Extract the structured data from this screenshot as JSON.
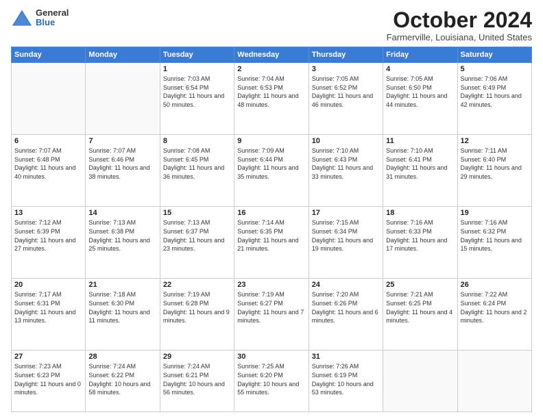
{
  "header": {
    "logo_general": "General",
    "logo_blue": "Blue",
    "month_title": "October 2024",
    "subtitle": "Farmerville, Louisiana, United States"
  },
  "days_of_week": [
    "Sunday",
    "Monday",
    "Tuesday",
    "Wednesday",
    "Thursday",
    "Friday",
    "Saturday"
  ],
  "weeks": [
    [
      {
        "day": "",
        "info": ""
      },
      {
        "day": "",
        "info": ""
      },
      {
        "day": "1",
        "info": "Sunrise: 7:03 AM\nSunset: 6:54 PM\nDaylight: 11 hours and 50 minutes."
      },
      {
        "day": "2",
        "info": "Sunrise: 7:04 AM\nSunset: 6:53 PM\nDaylight: 11 hours and 48 minutes."
      },
      {
        "day": "3",
        "info": "Sunrise: 7:05 AM\nSunset: 6:52 PM\nDaylight: 11 hours and 46 minutes."
      },
      {
        "day": "4",
        "info": "Sunrise: 7:05 AM\nSunset: 6:50 PM\nDaylight: 11 hours and 44 minutes."
      },
      {
        "day": "5",
        "info": "Sunrise: 7:06 AM\nSunset: 6:49 PM\nDaylight: 11 hours and 42 minutes."
      }
    ],
    [
      {
        "day": "6",
        "info": "Sunrise: 7:07 AM\nSunset: 6:48 PM\nDaylight: 11 hours and 40 minutes."
      },
      {
        "day": "7",
        "info": "Sunrise: 7:07 AM\nSunset: 6:46 PM\nDaylight: 11 hours and 38 minutes."
      },
      {
        "day": "8",
        "info": "Sunrise: 7:08 AM\nSunset: 6:45 PM\nDaylight: 11 hours and 36 minutes."
      },
      {
        "day": "9",
        "info": "Sunrise: 7:09 AM\nSunset: 6:44 PM\nDaylight: 11 hours and 35 minutes."
      },
      {
        "day": "10",
        "info": "Sunrise: 7:10 AM\nSunset: 6:43 PM\nDaylight: 11 hours and 33 minutes."
      },
      {
        "day": "11",
        "info": "Sunrise: 7:10 AM\nSunset: 6:41 PM\nDaylight: 11 hours and 31 minutes."
      },
      {
        "day": "12",
        "info": "Sunrise: 7:11 AM\nSunset: 6:40 PM\nDaylight: 11 hours and 29 minutes."
      }
    ],
    [
      {
        "day": "13",
        "info": "Sunrise: 7:12 AM\nSunset: 6:39 PM\nDaylight: 11 hours and 27 minutes."
      },
      {
        "day": "14",
        "info": "Sunrise: 7:13 AM\nSunset: 6:38 PM\nDaylight: 11 hours and 25 minutes."
      },
      {
        "day": "15",
        "info": "Sunrise: 7:13 AM\nSunset: 6:37 PM\nDaylight: 11 hours and 23 minutes."
      },
      {
        "day": "16",
        "info": "Sunrise: 7:14 AM\nSunset: 6:35 PM\nDaylight: 11 hours and 21 minutes."
      },
      {
        "day": "17",
        "info": "Sunrise: 7:15 AM\nSunset: 6:34 PM\nDaylight: 11 hours and 19 minutes."
      },
      {
        "day": "18",
        "info": "Sunrise: 7:16 AM\nSunset: 6:33 PM\nDaylight: 11 hours and 17 minutes."
      },
      {
        "day": "19",
        "info": "Sunrise: 7:16 AM\nSunset: 6:32 PM\nDaylight: 11 hours and 15 minutes."
      }
    ],
    [
      {
        "day": "20",
        "info": "Sunrise: 7:17 AM\nSunset: 6:31 PM\nDaylight: 11 hours and 13 minutes."
      },
      {
        "day": "21",
        "info": "Sunrise: 7:18 AM\nSunset: 6:30 PM\nDaylight: 11 hours and 11 minutes."
      },
      {
        "day": "22",
        "info": "Sunrise: 7:19 AM\nSunset: 6:28 PM\nDaylight: 11 hours and 9 minutes."
      },
      {
        "day": "23",
        "info": "Sunrise: 7:19 AM\nSunset: 6:27 PM\nDaylight: 11 hours and 7 minutes."
      },
      {
        "day": "24",
        "info": "Sunrise: 7:20 AM\nSunset: 6:26 PM\nDaylight: 11 hours and 6 minutes."
      },
      {
        "day": "25",
        "info": "Sunrise: 7:21 AM\nSunset: 6:25 PM\nDaylight: 11 hours and 4 minutes."
      },
      {
        "day": "26",
        "info": "Sunrise: 7:22 AM\nSunset: 6:24 PM\nDaylight: 11 hours and 2 minutes."
      }
    ],
    [
      {
        "day": "27",
        "info": "Sunrise: 7:23 AM\nSunset: 6:23 PM\nDaylight: 11 hours and 0 minutes."
      },
      {
        "day": "28",
        "info": "Sunrise: 7:24 AM\nSunset: 6:22 PM\nDaylight: 10 hours and 58 minutes."
      },
      {
        "day": "29",
        "info": "Sunrise: 7:24 AM\nSunset: 6:21 PM\nDaylight: 10 hours and 56 minutes."
      },
      {
        "day": "30",
        "info": "Sunrise: 7:25 AM\nSunset: 6:20 PM\nDaylight: 10 hours and 55 minutes."
      },
      {
        "day": "31",
        "info": "Sunrise: 7:26 AM\nSunset: 6:19 PM\nDaylight: 10 hours and 53 minutes."
      },
      {
        "day": "",
        "info": ""
      },
      {
        "day": "",
        "info": ""
      }
    ]
  ]
}
